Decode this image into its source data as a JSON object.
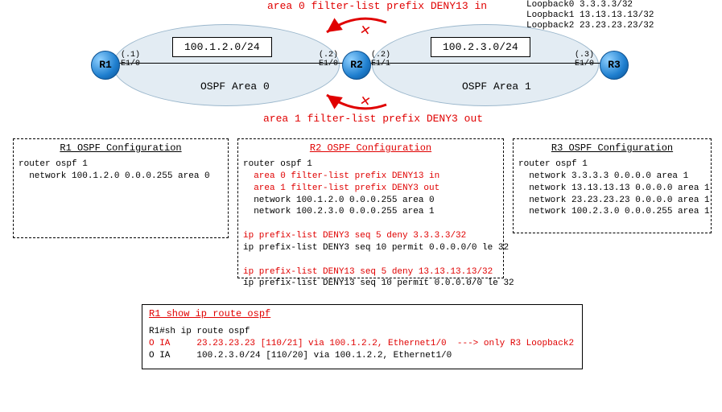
{
  "diagram": {
    "filter_in_label": "area 0 filter-list prefix DENY13 in",
    "filter_out_label": "area 1 filter-list prefix DENY3 out",
    "loopbacks_text": "Loopback0 3.3.3.3/32\nLoopback1 13.13.13.13/32\nLoopback2 23.23.23.23/32",
    "area0": {
      "net": "100.1.2.0/24",
      "label": "OSPF Area 0"
    },
    "area1": {
      "net": "100.2.3.0/24",
      "label": "OSPF Area 1"
    },
    "r1": {
      "name": "R1",
      "if_right": "(.1)\nE1/0"
    },
    "r2": {
      "name": "R2",
      "if_left": "(.2)\nE1/0",
      "if_right": "(.2)\nE1/1"
    },
    "r3": {
      "name": "R3",
      "if_left": "(.3)\nE1/0"
    }
  },
  "cfg": {
    "r1": {
      "title": "R1 OSPF Configuration",
      "lines": [
        {
          "t": "router ospf 1",
          "r": false
        },
        {
          "t": "  network 100.1.2.0 0.0.0.255 area 0",
          "r": false
        }
      ]
    },
    "r2": {
      "title": "R2 OSPF Configuration",
      "lines": [
        {
          "t": "router ospf 1",
          "r": false
        },
        {
          "t": "  area 0 filter-list prefix DENY13 in",
          "r": true
        },
        {
          "t": "  area 1 filter-list prefix DENY3 out",
          "r": true
        },
        {
          "t": "  network 100.1.2.0 0.0.0.255 area 0",
          "r": false
        },
        {
          "t": "  network 100.2.3.0 0.0.0.255 area 1",
          "r": false
        },
        {
          "t": "",
          "r": false
        },
        {
          "t": "ip prefix-list DENY3 seq 5 deny 3.3.3.3/32",
          "r": true
        },
        {
          "t": "ip prefix-list DENY3 seq 10 permit 0.0.0.0/0 le 32",
          "r": false
        },
        {
          "t": "",
          "r": false
        },
        {
          "t": "ip prefix-list DENY13 seq 5 deny 13.13.13.13/32",
          "r": true
        },
        {
          "t": "ip prefix-list DENY13 seq 10 permit 0.0.0.0/0 le 32",
          "r": false
        }
      ]
    },
    "r3": {
      "title": "R3 OSPF Configuration",
      "lines": [
        {
          "t": "router ospf 1",
          "r": false
        },
        {
          "t": "  network 3.3.3.3 0.0.0.0 area 1",
          "r": false
        },
        {
          "t": "  network 13.13.13.13 0.0.0.0 area 1",
          "r": false
        },
        {
          "t": "  network 23.23.23.23 0.0.0.0 area 1",
          "r": false
        },
        {
          "t": "  network 100.2.3.0 0.0.0.255 area 1",
          "r": false
        }
      ]
    }
  },
  "route": {
    "title": "R1 show ip route ospf",
    "lines": [
      {
        "t": "R1#sh ip route ospf",
        "r": false
      },
      {
        "t": "O IA     23.23.23.23 [110/21] via 100.1.2.2, Ethernet1/0  ---> only R3 Loopback2",
        "r": true
      },
      {
        "t": "O IA     100.2.3.0/24 [110/20] via 100.1.2.2, Ethernet1/0",
        "r": false
      }
    ]
  }
}
